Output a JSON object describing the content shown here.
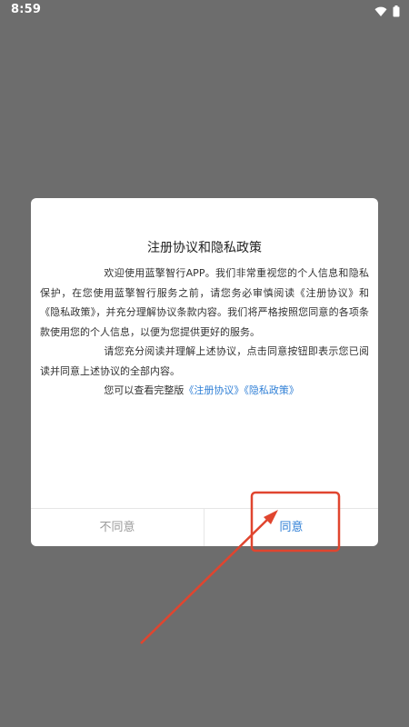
{
  "status_bar": {
    "time": "8:59",
    "icons": [
      "wifi-icon",
      "battery-icon"
    ]
  },
  "dialog": {
    "title": "注册协议和隐私政策",
    "paragraph1": "欢迎使用蓝擎智行APP。我们非常重视您的个人信息和隐私保护，在您使用蓝擎智行服务之前，请您务必审慎阅读《注册协议》和《隐私政策》，并充分理解协议条款内容。我们将严格按照您同意的各项条款使用您的个人信息，以便为您提供更好的服务。",
    "paragraph2": "请您充分阅读并理解上述协议，点击同意按钮即表示您已阅读并同意上述协议的全部内容。",
    "paragraph3_prefix": "您可以查看完整版",
    "link_register": "《注册协议》",
    "link_privacy": "《隐私政策》",
    "disagree_label": "不同意",
    "agree_label": "同意"
  },
  "annotation": {
    "color": "#e0452f"
  }
}
